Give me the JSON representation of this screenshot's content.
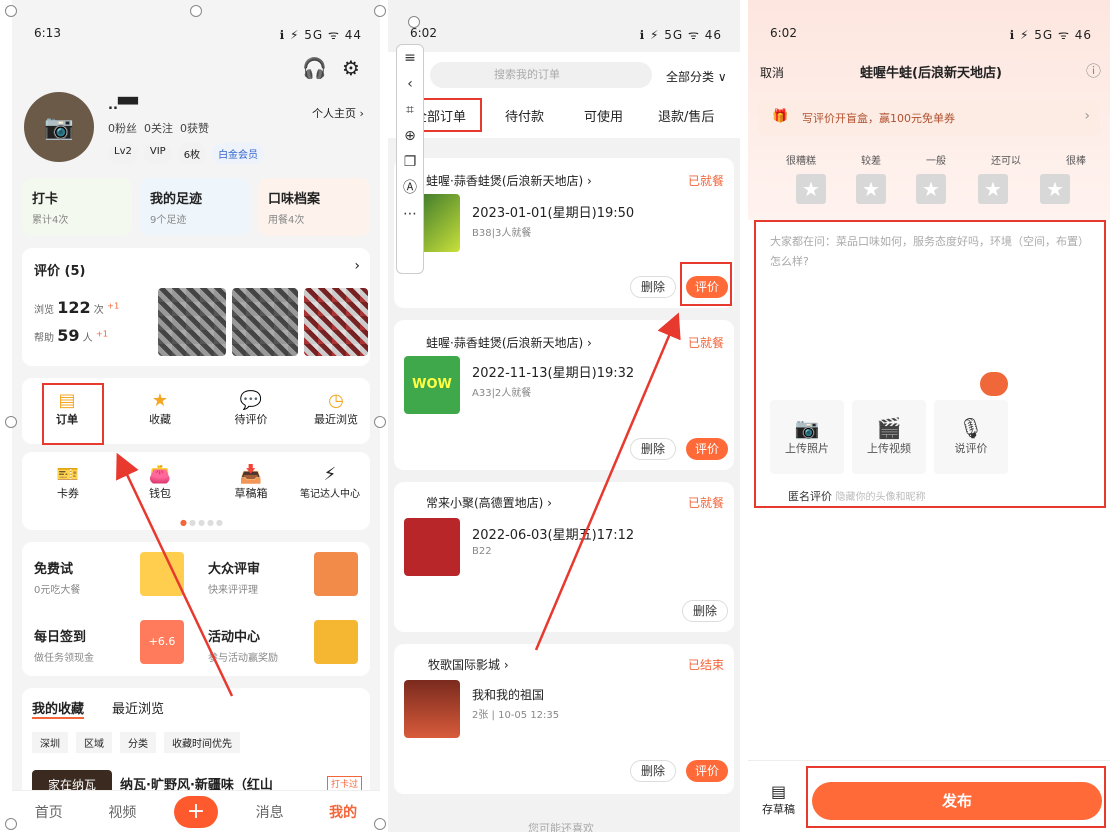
{
  "p1": {
    "status": {
      "time": "6:13",
      "right": "ℹ ⚡ 5G ᯤ 44"
    },
    "profile": {
      "name": "..▀▀",
      "fans": "0粉丝",
      "follow": "0关注",
      "likes": "0获赞",
      "home": "个人主页 ›",
      "badges": [
        "Lv2",
        "VIP",
        "6枚",
        "白金会员"
      ]
    },
    "quick": [
      {
        "title": "打卡",
        "sub": "累计4次"
      },
      {
        "title": "我的足迹",
        "sub": "9个足迹"
      },
      {
        "title": "口味档案",
        "sub": "用餐4次"
      }
    ],
    "review": {
      "title": "评价 (5)",
      "browse_label": "浏览",
      "browse_val": "122",
      "browse_unit": "次",
      "browse_plus": "+1",
      "help_label": "帮助",
      "help_val": "59",
      "help_unit": "人",
      "help_plus": "+1"
    },
    "grid1": [
      "订单",
      "收藏",
      "待评价",
      "最近浏览"
    ],
    "grid2": [
      "卡券",
      "钱包",
      "草稿箱",
      "笔记达人中心"
    ],
    "promos": [
      {
        "title": "免费试",
        "sub": "0元吃大餐"
      },
      {
        "title": "大众评审",
        "sub": "快来评评理"
      },
      {
        "title": "每日签到",
        "sub": "做任务领现金"
      },
      {
        "title": "活动中心",
        "sub": "参与活动赢奖励"
      }
    ],
    "promo_badge": "+6.6",
    "tabs": [
      "我的收藏",
      "最近浏览"
    ],
    "filters": [
      "深圳",
      "区域",
      "分类",
      "收藏时间优先"
    ],
    "fav": {
      "title": "纳瓦·旷野风·新疆味（红山",
      "tag": "打卡过",
      "img": "家在纳瓦"
    },
    "nav": [
      "首页",
      "视频",
      "+",
      "消息",
      "我的"
    ]
  },
  "p2": {
    "status": {
      "time": "6:02",
      "right": "ℹ ⚡ 5G ᯤ 46"
    },
    "search": "搜索我的订单",
    "category": "全部分类 ∨",
    "tabs": [
      "全部订单",
      "待付款",
      "可使用",
      "退款/售后"
    ],
    "orders": [
      {
        "shop": "蛙喔·蒜香蛙煲(后浪新天地店) ›",
        "status": "已就餐",
        "date": "2023-01-01(星期日)19:50",
        "desc": "B38|3人就餐",
        "b1": "删除",
        "b2": "评价"
      },
      {
        "shop": "蛙喔·蒜香蛙煲(后浪新天地店) ›",
        "status": "已就餐",
        "date": "2022-11-13(星期日)19:32",
        "desc": "A33|2人就餐",
        "b1": "删除",
        "b2": "评价"
      },
      {
        "shop": "常来小聚(高德置地店) ›",
        "status": "已就餐",
        "date": "2022-06-03(星期五)17:12",
        "desc": "B22",
        "b1": "删除"
      },
      {
        "shop": "牧歌国际影城 ›",
        "status": "已结束",
        "date": "我和我的祖国",
        "desc": "2张 | 10-05 12:35",
        "b1": "删除",
        "b2": "评价"
      }
    ],
    "footer": "您可能还喜欢",
    "img_text": "WOW"
  },
  "p3": {
    "status": {
      "time": "6:02",
      "right": "ℹ ⚡ 5G ᯤ 46"
    },
    "cancel": "取消",
    "title": "蛙喔牛蛙(后浪新天地店)",
    "banner": "写评价开盲盒，赢100元免单券",
    "ratings": [
      "很糟糕",
      "较差",
      "一般",
      "还可以",
      "很棒"
    ],
    "placeholder": "大家都在问：菜品口味如何，服务态度好吗，环境（空间，布置）怎么样?",
    "uploads": [
      "上传照片",
      "上传视频",
      "说评价"
    ],
    "anon_label": "匿名评价",
    "anon_hint": "隐藏你的头像和昵称",
    "draft": "存草稿",
    "publish": "发布"
  },
  "colors": {
    "accent": "#ff6a38",
    "annotation": "#e8392f"
  }
}
